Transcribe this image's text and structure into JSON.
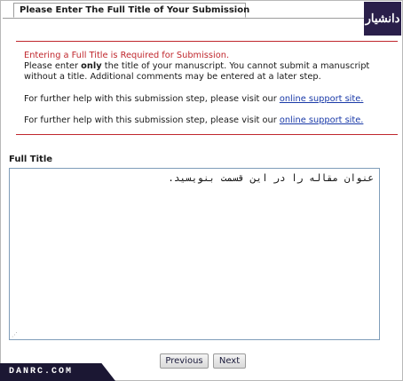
{
  "tab": {
    "title": "Please Enter The Full Title of Your Submission"
  },
  "logo": {
    "text": "دانشیار"
  },
  "messages": {
    "error": "Entering a Full Title is Required for Submission.",
    "line2_pre": "Please enter ",
    "line2_bold": "only",
    "line2_post": " the title of your manuscript. You cannot submit a manuscript",
    "line3": "without a title. Additional comments may be entered at a later step.",
    "help_pre": "For further help with this submission step, please visit our ",
    "help_link": "online support site."
  },
  "field": {
    "label": "Full Title",
    "value": "عنوان مقاله را در این قسمت بنویسید."
  },
  "buttons": {
    "previous": "Previous",
    "next": "Next"
  },
  "watermark": {
    "text": "DANRC.COM"
  }
}
